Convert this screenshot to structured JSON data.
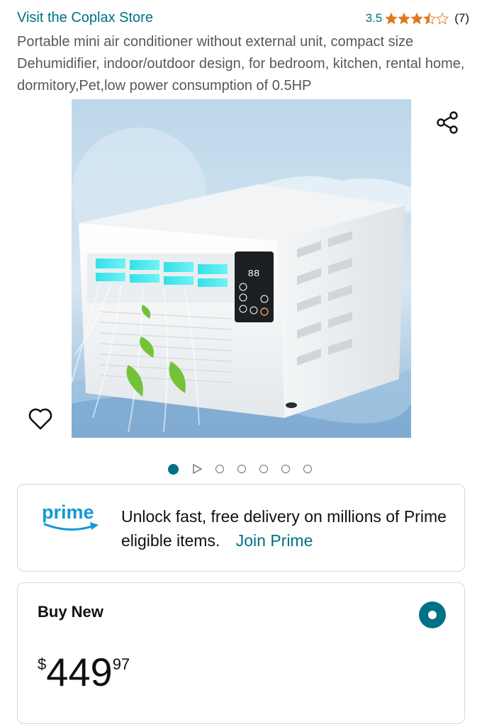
{
  "store": {
    "link_text": "Visit the Coplax Store",
    "rating_value": "3.5",
    "rating_stars": 3.5,
    "rating_count": "(7)"
  },
  "product": {
    "title": "Portable mini air conditioner without external unit, compact size Dehumidifier, indoor/outdoor design, for bedroom, kitchen, rental home, dormitory,Pet,low power consumption of 0.5HP",
    "image_icons": {
      "share": "share-icon",
      "favorite": "heart-icon"
    },
    "display_readout": "88"
  },
  "carousel": {
    "total": 7,
    "active_index": 0
  },
  "prime": {
    "logo_text": "prime",
    "message": "Unlock fast, free delivery on millions of Prime eligible items.",
    "join_label": "Join Prime"
  },
  "buy": {
    "label": "Buy New",
    "currency": "$",
    "price_whole": "449",
    "price_fraction": "97"
  },
  "colors": {
    "link": "#007185",
    "star": "#de7921",
    "prime_blue": "#1399d5",
    "prime_arrow": "#f5a623"
  }
}
